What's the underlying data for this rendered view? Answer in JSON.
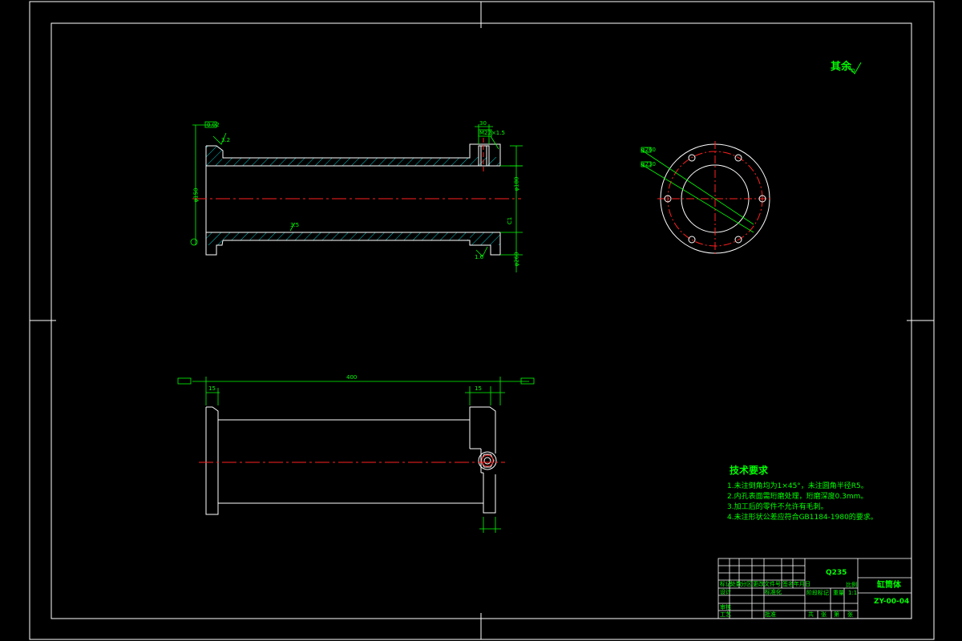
{
  "surface_roughness": {
    "label": "其余"
  },
  "dimensions": {
    "overall_length": "400",
    "flange_thickness": "15",
    "bore_dia": "φ150",
    "outer_dia": "φ180",
    "bolt_circle": "φ230",
    "flange_od": "φ260",
    "port_hole": "M22×1.5",
    "port_width": "30",
    "wall": "3.5",
    "chamfer": "C1",
    "roughness_1": "3.2",
    "roughness_2": "1.6",
    "tolerance": "0.02"
  },
  "technical_requirements": {
    "title": "技术要求",
    "items": [
      "1.未注倒角均为1×45°，未注圆角半径R5。",
      "2.内孔表面需珩磨处理，珩磨深度0.3mm。",
      "3.加工后的零件不允许有毛刺。",
      "4.未注形状公差应符合GB1184-1980的要求。"
    ]
  },
  "title_block": {
    "material": "Q235",
    "part_name": "缸筒体",
    "drawing_number": "ZY-00-04",
    "scale": "1:1",
    "row_labels": [
      "标记",
      "设计",
      "审核",
      "工艺"
    ],
    "column_labels": [
      "处数",
      "分区",
      "更改文件号",
      "签名",
      "年月日"
    ],
    "stage_label": "阶段标记",
    "weight_label": "重量",
    "scale_label": "比例",
    "sheet_labels": [
      "共",
      "张",
      "第",
      "张"
    ],
    "standardization_label": "标准化",
    "approval_label": "批准"
  }
}
